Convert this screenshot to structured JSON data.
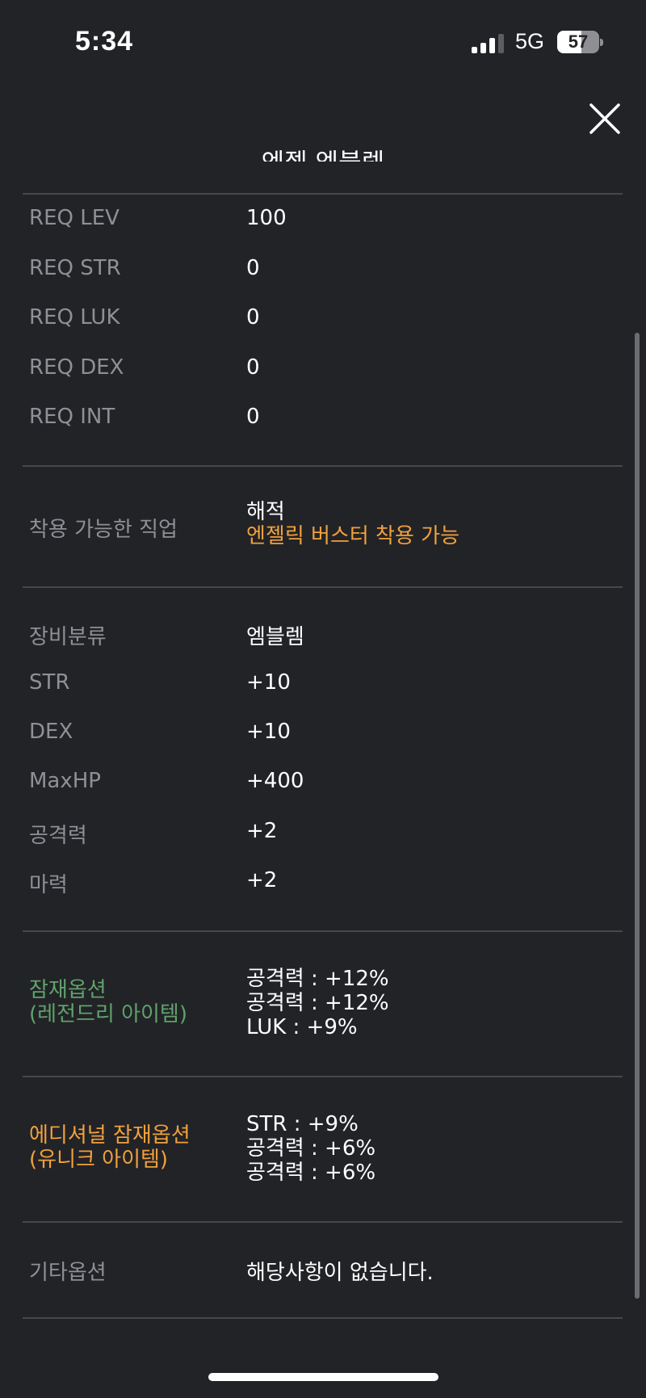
{
  "status_bar": {
    "time": "5:34",
    "network": "5G",
    "battery": "57",
    "battery_level": 0.57
  },
  "item_name": "엔젤 엠블렘",
  "requirements": [
    {
      "label": "REQ LEV",
      "value": "100"
    },
    {
      "label": "REQ STR",
      "value": "0"
    },
    {
      "label": "REQ LUK",
      "value": "0"
    },
    {
      "label": "REQ DEX",
      "value": "0"
    },
    {
      "label": "REQ INT",
      "value": "0"
    }
  ],
  "jobs": {
    "label": "착용 가능한 직업",
    "value": "해적",
    "note": "엔젤릭 버스터 착용 가능",
    "note_color": "#f0a13c"
  },
  "stats": [
    {
      "label": "장비분류",
      "value": "엠블렘"
    },
    {
      "label": "STR",
      "value": "+10"
    },
    {
      "label": "DEX",
      "value": "+10"
    },
    {
      "label": "MaxHP",
      "value": "+400"
    },
    {
      "label": "공격력",
      "value": "+2"
    },
    {
      "label": "마력",
      "value": "+2"
    }
  ],
  "potential": {
    "label_line1": "잠재옵션",
    "label_line2": "(레전드리 아이템)",
    "label_color": "#5fa36b",
    "lines": [
      "공격력 : +12%",
      "공격력 : +12%",
      "LUK : +9%"
    ]
  },
  "additional_potential": {
    "label_line1": "에디셔널 잠재옵션",
    "label_line2": "(유니크 아이템)",
    "label_color": "#f0a13c",
    "lines": [
      "STR : +9%",
      "공격력 : +6%",
      "공격력 : +6%"
    ]
  },
  "other": {
    "label": "기타옵션",
    "value": "해당사항이 없습니다."
  },
  "icons": {
    "close": "close-icon",
    "signal": "cellular-signal-icon",
    "battery": "battery-icon"
  }
}
